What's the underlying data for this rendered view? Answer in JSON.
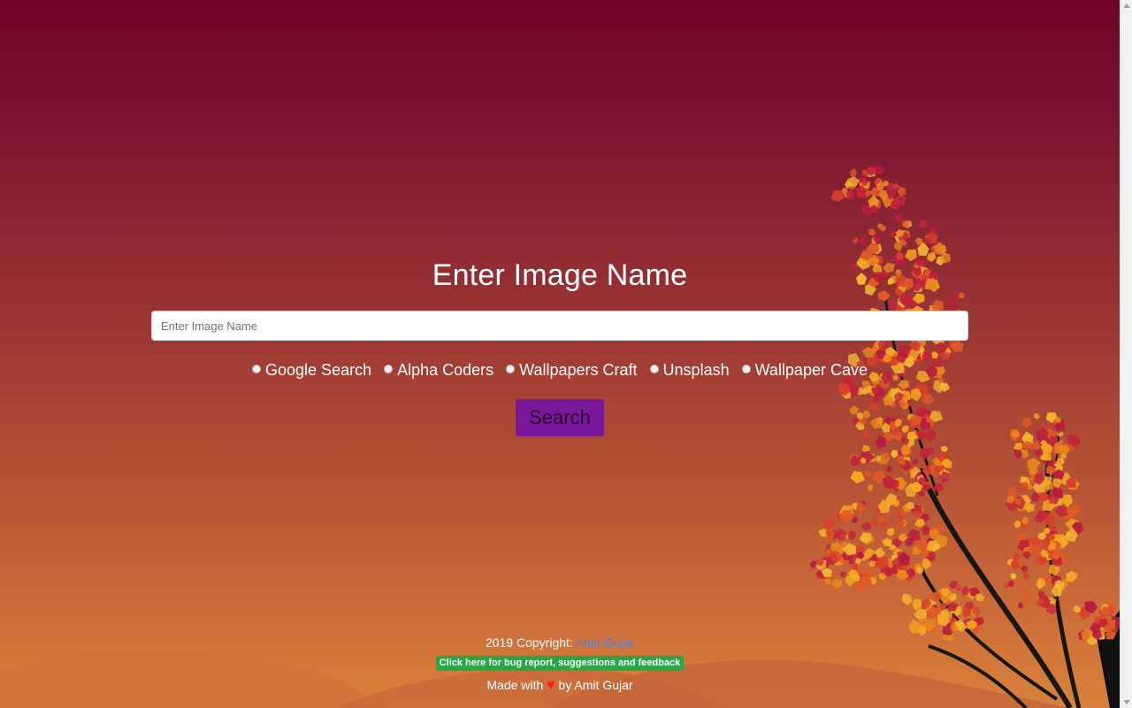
{
  "page": {
    "title": "Enter Image Name"
  },
  "search": {
    "placeholder": "Enter Image Name",
    "value": "",
    "button_label": "Search"
  },
  "sources": [
    {
      "label": "Google Search",
      "checked": false
    },
    {
      "label": "Alpha Coders",
      "checked": false
    },
    {
      "label": "Wallpapers Craft",
      "checked": false
    },
    {
      "label": "Unsplash",
      "checked": false
    },
    {
      "label": "Wallpaper Cave",
      "checked": false
    }
  ],
  "footer": {
    "copyright_prefix": "2019 Copyright:",
    "author_link": "Amit Gujar",
    "feedback_badge": "Click here for bug report, suggestions and feedback",
    "made_with": "Made with",
    "heart_icon": "heart-icon",
    "by_author": "by Amit Gujar"
  },
  "colors": {
    "button": "#7a189c",
    "link": "#4d7fe0",
    "badge": "#28a745",
    "heart": "#ff1a1a"
  }
}
